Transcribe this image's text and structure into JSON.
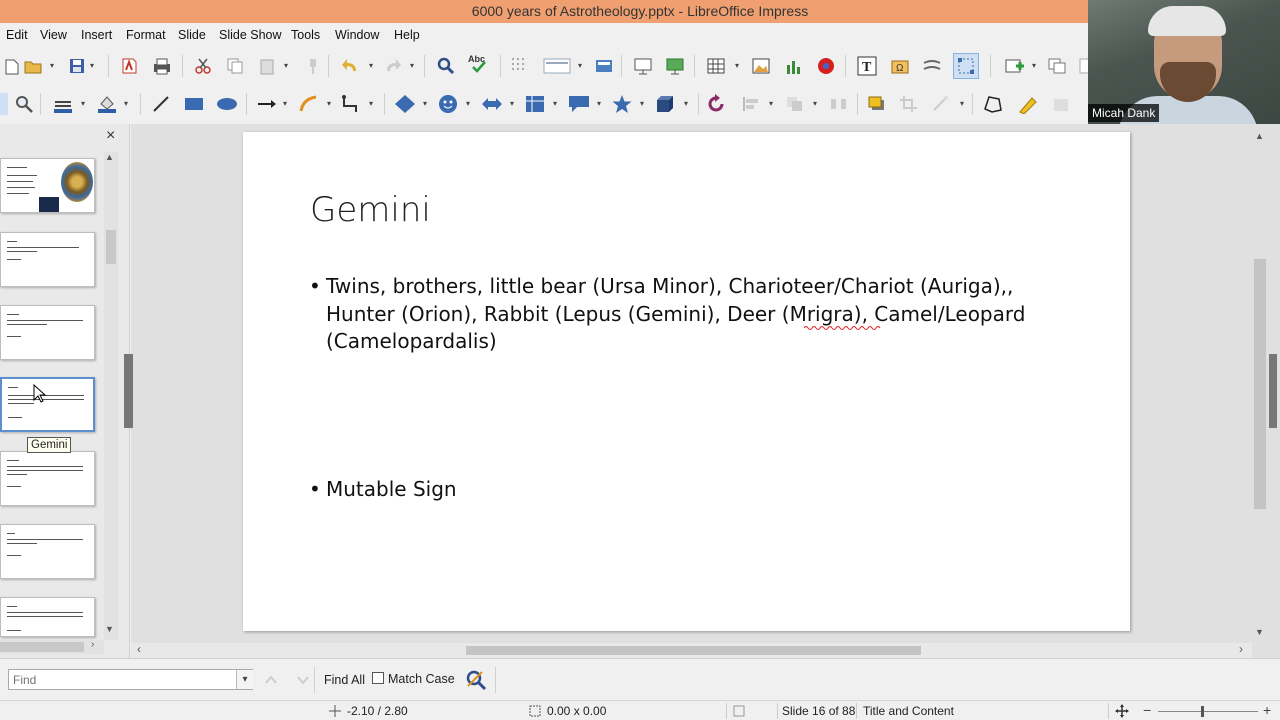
{
  "window": {
    "title": "6000 years of Astrotheology.pptx - LibreOffice Impress"
  },
  "menu": [
    "Edit",
    "View",
    "Insert",
    "Format",
    "Slide",
    "Slide Show",
    "Tools",
    "Window",
    "Help"
  ],
  "webcam": {
    "name": "Micah Dank"
  },
  "slide_panel": {
    "tooltip": "Gemini",
    "close_glyph": "×"
  },
  "slide": {
    "title": "Gemini",
    "bullets": [
      {
        "lines": [
          "Twins, brothers, little bear (Ursa Minor), Charioteer/Chariot (Auriga),,",
          "Hunter (Orion), Rabbit (Lepus (Gemini), Deer (Mrigra), Camel/Leopard",
          "(Camelopardalis)"
        ]
      },
      {
        "lines": [
          "Mutable Sign"
        ]
      }
    ],
    "bullet_glyph": "•"
  },
  "findbar": {
    "placeholder": "Find",
    "find_all": "Find All",
    "match_case": "Match Case"
  },
  "status": {
    "position": "-2.10 / 2.80",
    "size": "0.00 x 0.00",
    "slide": "Slide 16 of 88",
    "layout": "Title and Content"
  },
  "colors": {
    "titlebar": "#f0a070",
    "selection": "#5b8fd0"
  }
}
